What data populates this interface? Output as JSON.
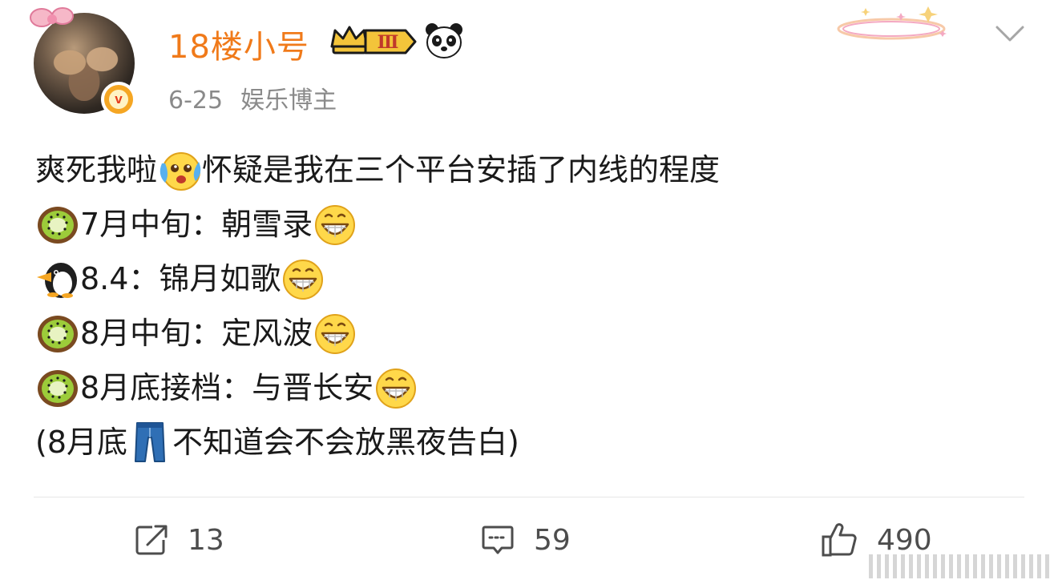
{
  "post": {
    "author": {
      "name": "18楼小号",
      "verified_mark": "v",
      "level_badge": "Ⅲ",
      "icons": [
        "avatar",
        "crown-badge-icon",
        "panda-icon",
        "verified-icon"
      ]
    },
    "date": "6-25",
    "source": "娱乐博主",
    "lines": [
      {
        "parts": [
          {
            "t": "爽死我啦"
          },
          {
            "e": "crying-laugh-emoji"
          },
          {
            "t": "怀疑是我在三个平台安插了内线的程度"
          }
        ]
      },
      {
        "parts": [
          {
            "e": "kiwi-emoji"
          },
          {
            "t": "7月中旬：朝雪录"
          },
          {
            "e": "grin-emoji"
          }
        ]
      },
      {
        "parts": [
          {
            "e": "penguin-emoji"
          },
          {
            "t": "8.4：锦月如歌"
          },
          {
            "e": "grin-emoji"
          }
        ]
      },
      {
        "parts": [
          {
            "e": "kiwi-emoji"
          },
          {
            "t": "8月中旬：定风波"
          },
          {
            "e": "grin-emoji"
          }
        ]
      },
      {
        "parts": [
          {
            "e": "kiwi-emoji"
          },
          {
            "t": "8月底接档：与晋长安"
          },
          {
            "e": "grin-emoji"
          }
        ]
      },
      {
        "parts": [
          {
            "t": "(8月底"
          },
          {
            "e": "jeans-emoji"
          },
          {
            "t": "不知道会不会放黑夜告白)"
          }
        ]
      }
    ]
  },
  "actions": {
    "forward": {
      "count": "13",
      "icon": "share-icon"
    },
    "comment": {
      "count": "59",
      "icon": "comment-icon"
    },
    "like": {
      "count": "490",
      "icon": "thumbs-up-icon"
    }
  },
  "colors": {
    "username": "#f07a1a",
    "meta": "#8a8a8a",
    "text": "#1a1a1a",
    "verified_badge": "#f5a623"
  }
}
